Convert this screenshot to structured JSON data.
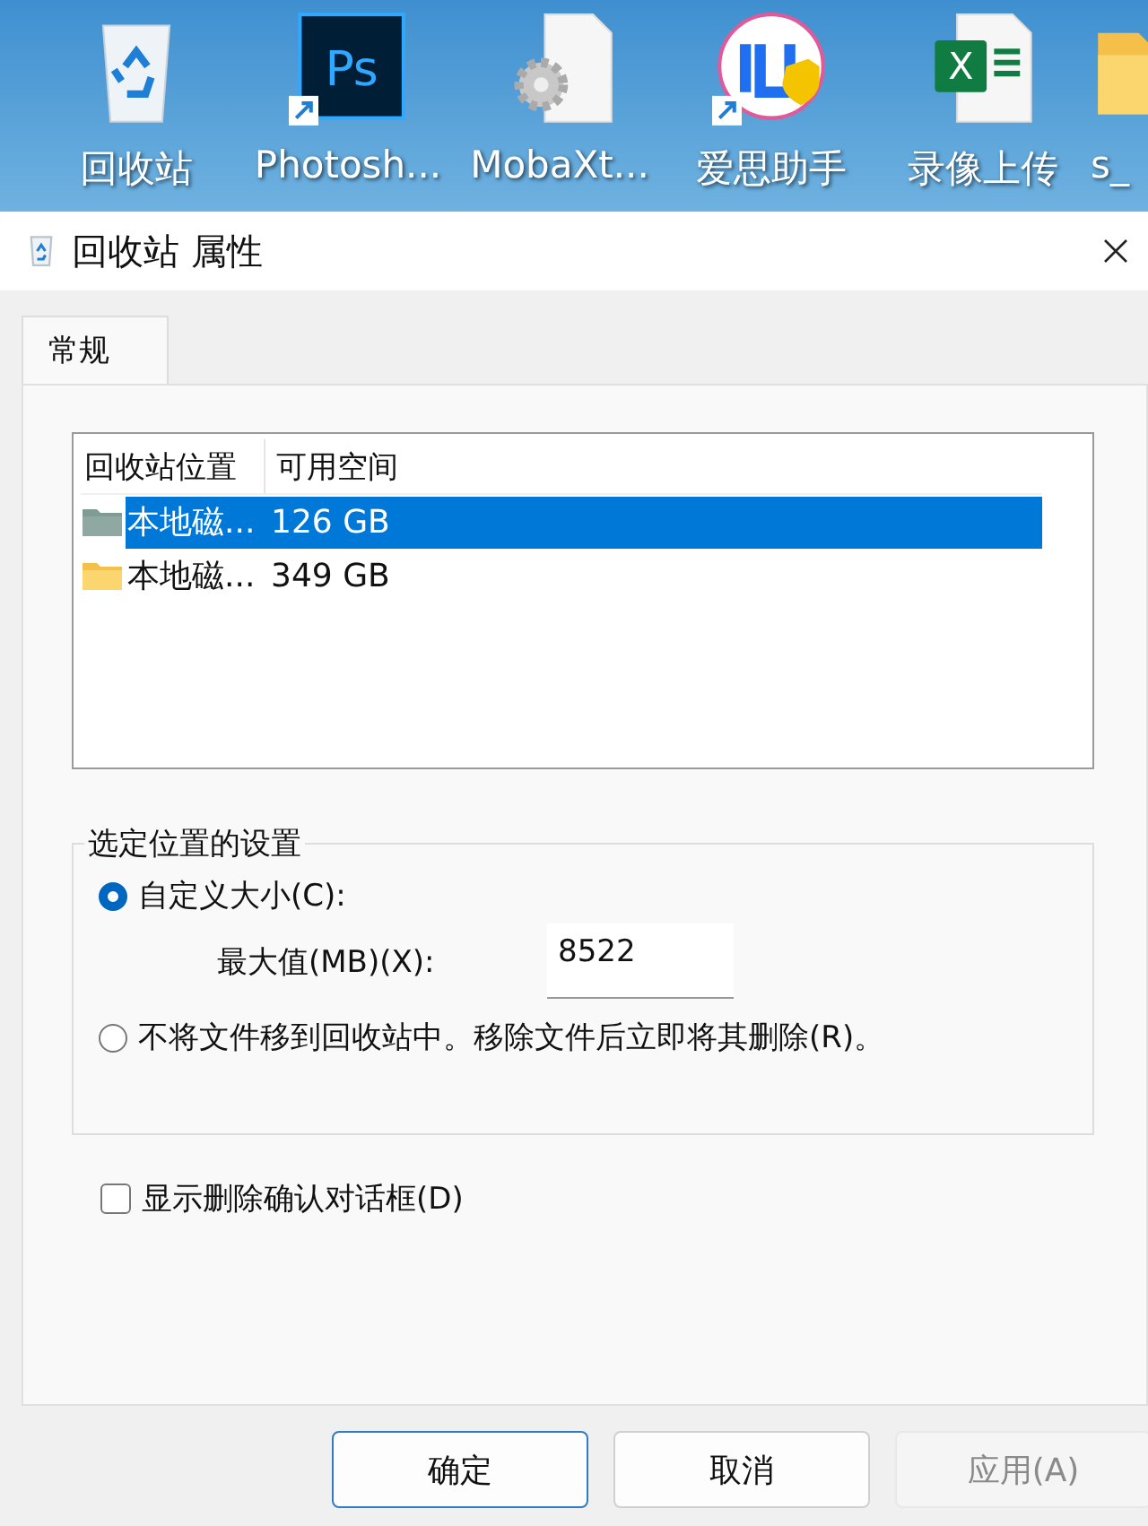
{
  "desktop": {
    "icons": [
      {
        "kind": "recycle-bin",
        "label": "回收站",
        "shortcut": false
      },
      {
        "kind": "photoshop",
        "label": "Photosh...",
        "shortcut": true,
        "glyph": "Ps"
      },
      {
        "kind": "settings-file",
        "label": "MobaXt...",
        "shortcut": false
      },
      {
        "kind": "app-logo",
        "label": "爱思助手",
        "shortcut": true
      },
      {
        "kind": "spreadsheet",
        "label": "录像上传",
        "shortcut": false,
        "glyph": "X"
      },
      {
        "kind": "folder",
        "label": "s_",
        "shortcut": false
      }
    ]
  },
  "window": {
    "title": "回收站 属性"
  },
  "tabs": [
    {
      "label": "常规",
      "selected": true
    }
  ],
  "table": {
    "columns": [
      "回收站位置",
      "可用空间"
    ],
    "rows": [
      {
        "location": "本地磁...",
        "free": "126 GB",
        "selected": true
      },
      {
        "location": "本地磁...",
        "free": "349 GB",
        "selected": false
      }
    ]
  },
  "settings_group": {
    "title": "选定位置的设置",
    "options": [
      {
        "label": "自定义大小(C):",
        "selected": true
      },
      {
        "label": "不将文件移到回收站中。移除文件后立即将其删除(R)。",
        "selected": false
      }
    ],
    "max_size": {
      "label": "最大值(MB)(X):",
      "value": "8522"
    }
  },
  "confirm_checkbox": {
    "label": "显示删除确认对话框(D)",
    "checked": false
  },
  "buttons": [
    {
      "label": "确定",
      "default": true,
      "disabled": false
    },
    {
      "label": "取消",
      "default": false,
      "disabled": false
    },
    {
      "label": "应用(A)",
      "default": false,
      "disabled": true
    }
  ]
}
